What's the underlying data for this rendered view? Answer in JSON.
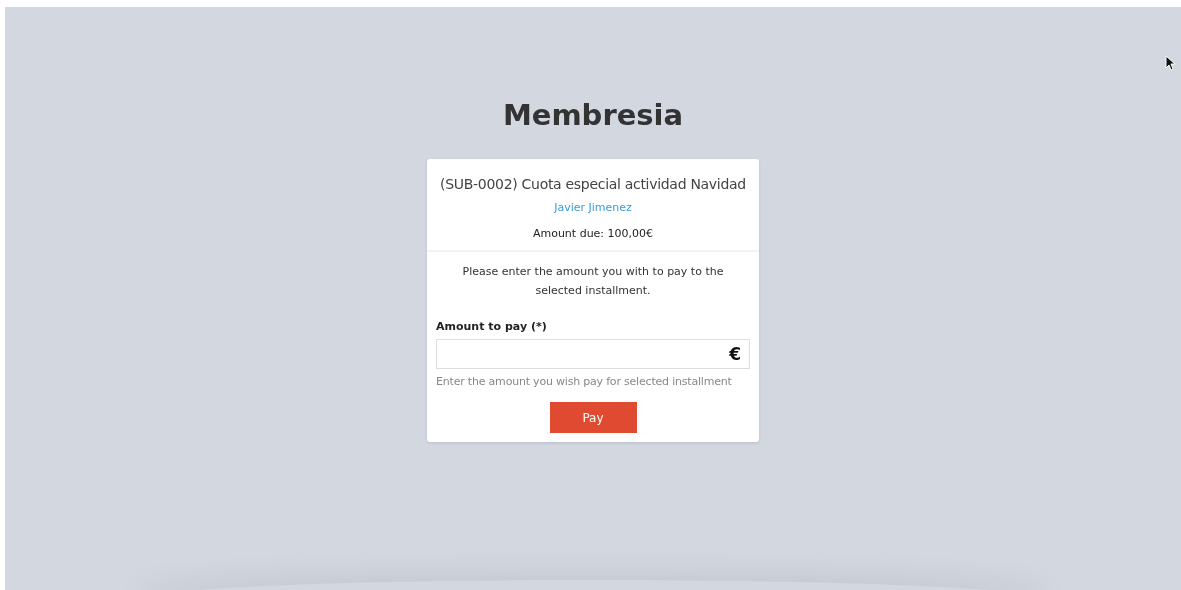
{
  "page_title": "Membresia",
  "card": {
    "subscription": "(SUB-0002) Cuota especial actividad Navidad",
    "member": "Javier Jimenez",
    "amount_due": "Amount due: 100,00€",
    "instructions": "Please enter the amount you with to pay to the selected installment.",
    "field": {
      "label": "Amount to pay (*)",
      "currency": "€",
      "help": "Enter the amount you wish pay for selected installment"
    },
    "button": "Pay"
  }
}
